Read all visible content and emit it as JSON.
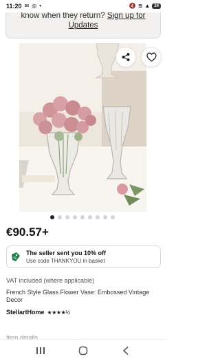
{
  "status_bar": {
    "time": "11:20",
    "battery": "24"
  },
  "banner": {
    "text": "know when they return?",
    "link": "Sign up for",
    "link2": "Updates"
  },
  "gallery": {
    "image_count": 9,
    "active_index": 0
  },
  "product": {
    "price": "€90.57+",
    "vat": "VAT included (where applicable)",
    "title": "French Style Glass Flower Vase: Embossed Vintage Decor",
    "seller": "StellartHome",
    "rating": 4.5,
    "rating_stars": "★★★★½",
    "partial_section": "Item details"
  },
  "coupon": {
    "title": "The seller sent you 10% off",
    "subtitle": "Use code THANKYOU in basket"
  },
  "colors": {
    "brand_orange": "#f1641e",
    "coupon_green": "#1f7a4c"
  }
}
